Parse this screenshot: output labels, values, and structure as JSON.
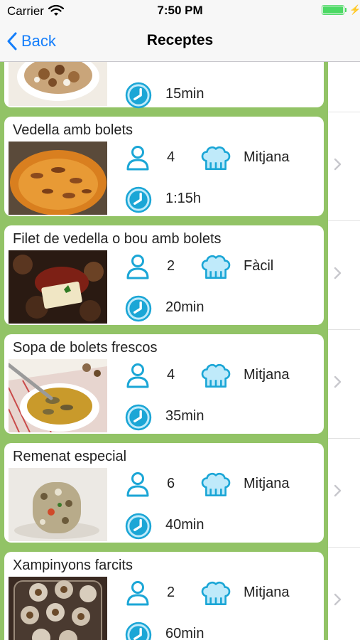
{
  "status_bar": {
    "carrier": "Carrier",
    "time": "7:50 PM"
  },
  "nav": {
    "back_label": "Back",
    "title": "Receptes"
  },
  "recipes": [
    {
      "name": "",
      "servings": "",
      "difficulty": "",
      "time": "15min",
      "photo": "mushroom-dish"
    },
    {
      "name": "Vedella amb bolets",
      "servings": "4",
      "difficulty": "Mitjana",
      "time": "1:15h",
      "photo": "veal-stew"
    },
    {
      "name": "Filet de vedella o bou amb bolets",
      "servings": "2",
      "difficulty": "Fàcil",
      "time": "20min",
      "photo": "fillet-mushrooms"
    },
    {
      "name": "Sopa de bolets frescos",
      "servings": "4",
      "difficulty": "Mitjana",
      "time": "35min",
      "photo": "mushroom-soup"
    },
    {
      "name": "Remenat especial",
      "servings": "6",
      "difficulty": "Mitjana",
      "time": "40min",
      "photo": "scrambled-eggs"
    },
    {
      "name": "Xampinyons farcits",
      "servings": "2",
      "difficulty": "Mitjana",
      "time": "60min",
      "photo": "stuffed-mushrooms"
    }
  ],
  "colors": {
    "accent": "#147efb",
    "card_border": "#92c366",
    "icon": "#1ba6d6",
    "battery": "#4cd964"
  }
}
